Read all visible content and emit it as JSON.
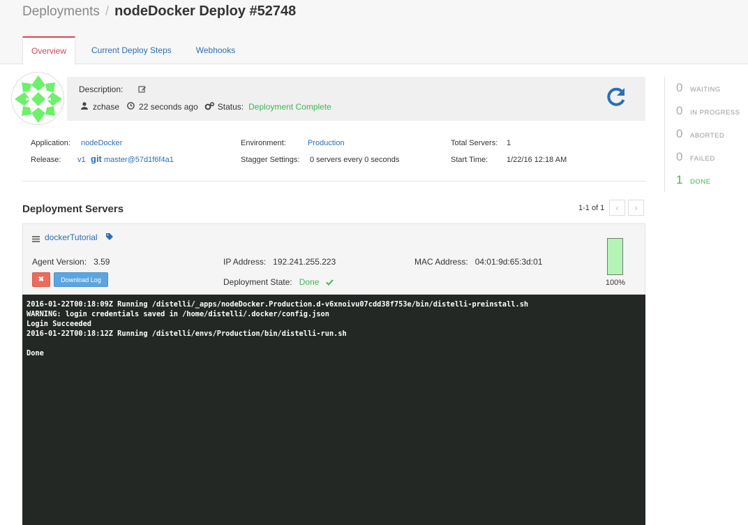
{
  "breadcrumb": {
    "parent": "Deployments",
    "separator": "/",
    "current": "nodeDocker Deploy #52748"
  },
  "tabs": [
    {
      "label": "Overview",
      "active": true
    },
    {
      "label": "Current Deploy Steps",
      "active": false
    },
    {
      "label": "Webhooks",
      "active": false
    }
  ],
  "summary": {
    "description_label": "Description:",
    "user": "zchase",
    "time_ago": "22 seconds ago",
    "status_label": "Status:",
    "status_value": "Deployment Complete"
  },
  "info": {
    "application_label": "Application:",
    "application_value": "nodeDocker",
    "release_label": "Release:",
    "release_version": "v1",
    "release_git": "git",
    "release_commit": "master@57d1f6f4a1",
    "environment_label": "Environment:",
    "environment_value": "Production",
    "stagger_label": "Stagger Settings:",
    "stagger_value": "0 servers every 0 seconds",
    "total_servers_label": "Total Servers:",
    "total_servers_value": "1",
    "start_time_label": "Start Time:",
    "start_time_value": "1/22/16 12:18 AM"
  },
  "stats": [
    {
      "count": "0",
      "label": "WAITING"
    },
    {
      "count": "0",
      "label": "IN PROGRESS"
    },
    {
      "count": "0",
      "label": "ABORTED"
    },
    {
      "count": "0",
      "label": "FAILED"
    },
    {
      "count": "1",
      "label": "DONE"
    }
  ],
  "servers_section": {
    "title": "Deployment Servers",
    "pager": "1-1 of 1",
    "prev_icon": "‹",
    "next_icon": "›"
  },
  "server": {
    "name": "dockerTutorial",
    "agent_version_label": "Agent Version:",
    "agent_version_value": "3.59",
    "ip_label": "IP Address:",
    "ip_value": "192.241.255.223",
    "mac_label": "MAC Address:",
    "mac_value": "04:01:9d:65:3d:01",
    "state_label": "Deployment State:",
    "state_value": "Done",
    "cancel_label": "✖",
    "download_label": "Download Log",
    "progress": 1.0,
    "progress_text": "100%"
  },
  "console_lines": "2016-01-22T00:18:09Z Running /distelli/_apps/nodeDocker.Production.d-v6xnoivu07cdd38f753e/bin/distelli-preinstall.sh\nWARNING: login credentials saved in /home/distelli/.docker/config.json\nLogin Succeeded\n2016-01-22T00:18:12Z Running /distelli/envs/Production/bin/distelli-run.sh\n\nDone",
  "colors": {
    "accent": "#2a6fb5",
    "success": "#3fb650",
    "danger": "#e96c5f",
    "active_tab": "#d0495a",
    "console_bg": "#242824"
  }
}
